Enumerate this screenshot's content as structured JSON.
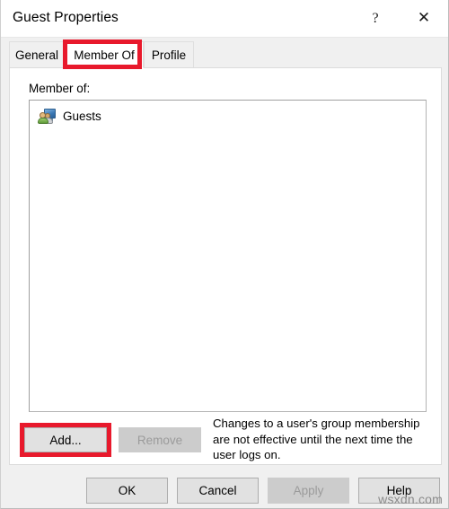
{
  "window": {
    "title": "Guest Properties",
    "help_button": "?",
    "close_button": "✕"
  },
  "tabs": [
    {
      "label": "General",
      "active": false
    },
    {
      "label": "Member Of",
      "active": true
    },
    {
      "label": "Profile",
      "active": false
    }
  ],
  "panel": {
    "member_of_label": "Member of:",
    "list_items": [
      {
        "label": "Guests",
        "icon": "group-icon"
      }
    ],
    "add_button": "Add...",
    "remove_button": "Remove",
    "hint_text": "Changes to a user's group membership are not effective until the next time the user logs on."
  },
  "footer": {
    "ok_button": "OK",
    "cancel_button": "Cancel",
    "apply_button": "Apply",
    "help_button": "Help"
  },
  "watermark": "wsxdn.com",
  "colors": {
    "annotation": "#e8192c",
    "dialog_background": "#f0f0f0",
    "panel_background": "#ffffff",
    "button_face": "#e1e1e1",
    "disabled_face": "#cccccc",
    "disabled_text": "#9b9b9b"
  }
}
